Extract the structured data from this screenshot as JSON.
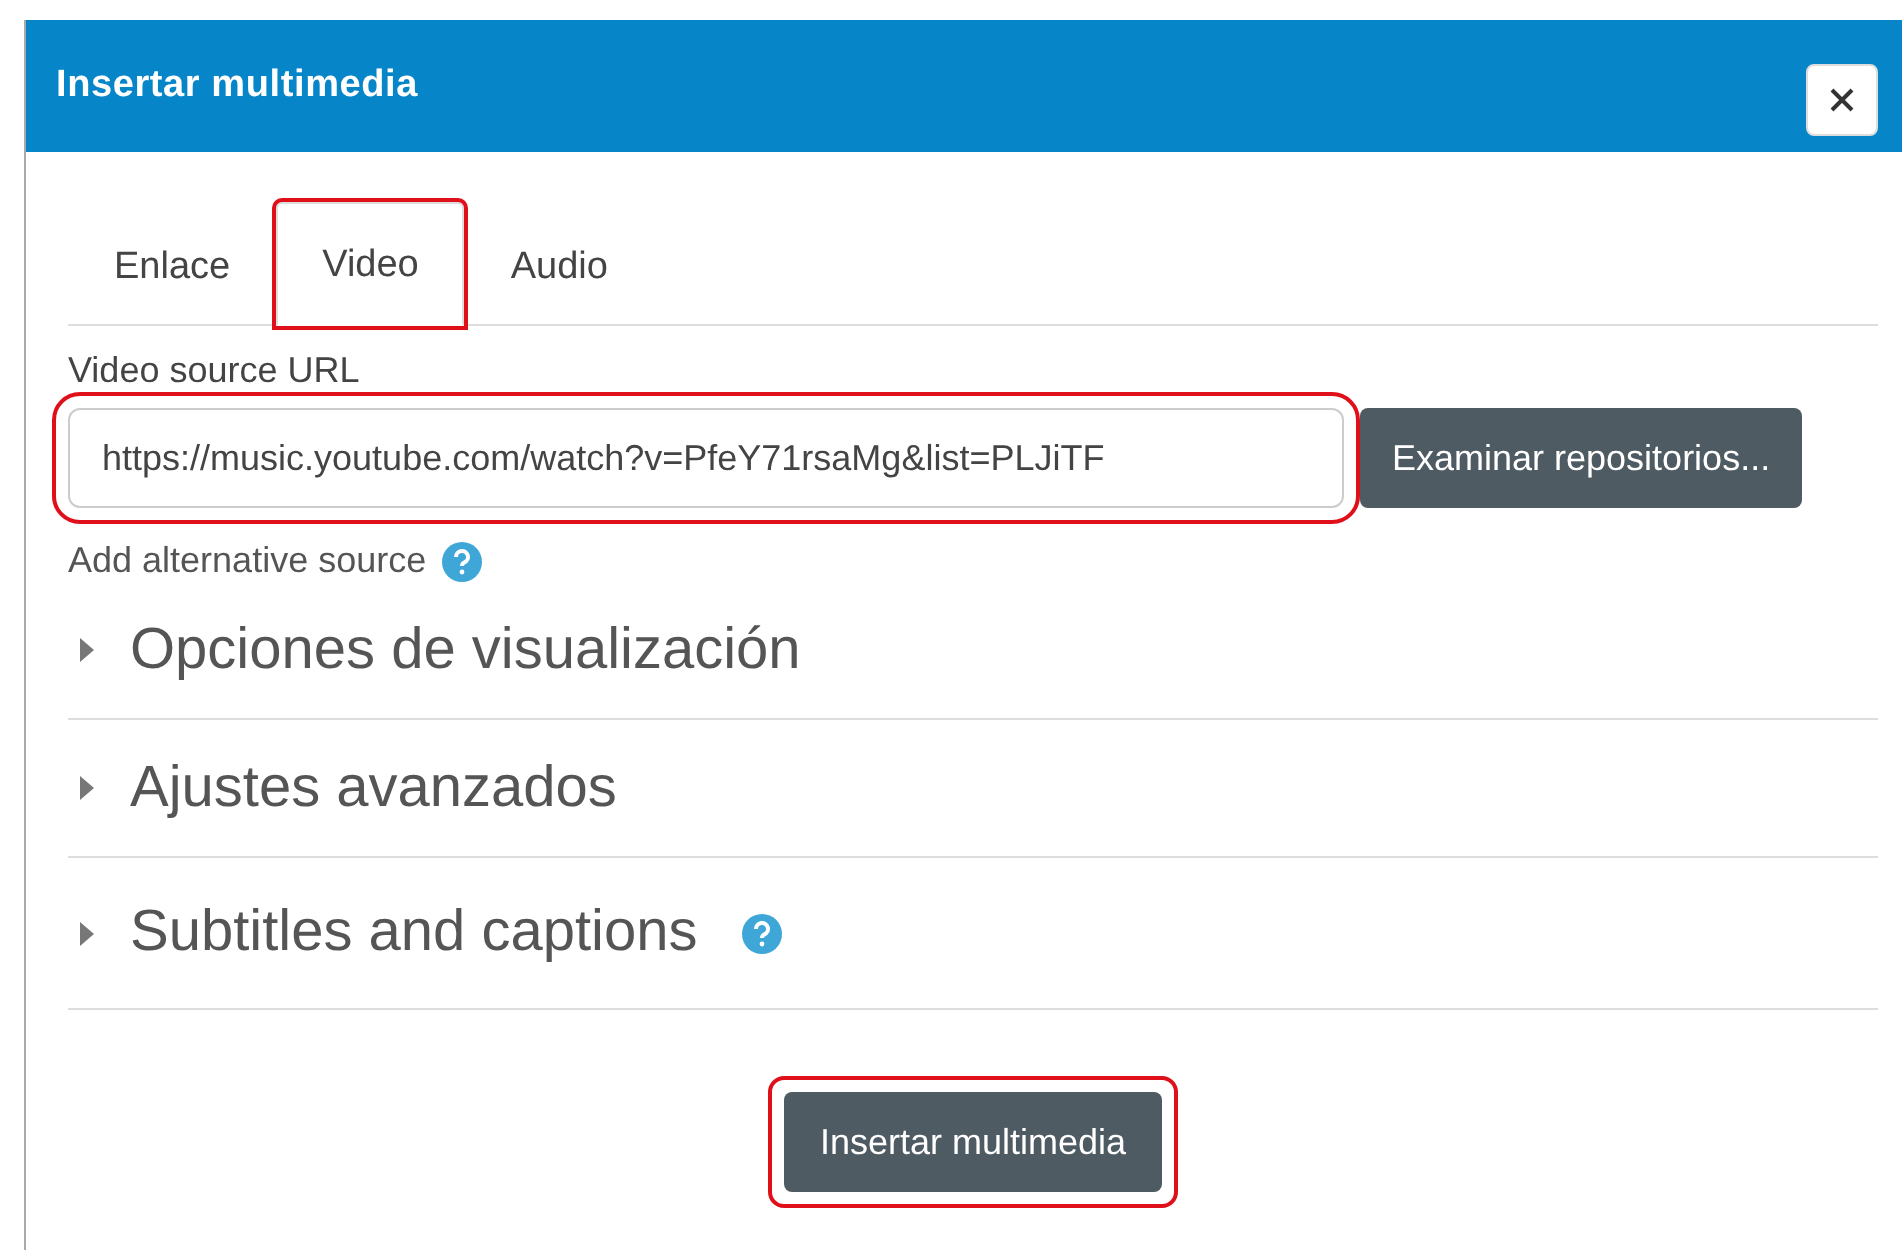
{
  "window": {
    "title": "Insertar multimedia"
  },
  "tabs": [
    {
      "label": "Enlace",
      "selected": false,
      "highlighted": false
    },
    {
      "label": "Video",
      "selected": true,
      "highlighted": true
    },
    {
      "label": "Audio",
      "selected": false,
      "highlighted": false
    }
  ],
  "source": {
    "label": "Video source URL",
    "value": "https://music.youtube.com/watch?v=PfeY71rsaMg&list=PLJiTF",
    "highlighted": true,
    "browse_button": "Examinar repositorios..."
  },
  "alternative_link": "Add alternative source",
  "sections": [
    {
      "title": "Opciones de visualización",
      "expanded": false,
      "help": false
    },
    {
      "title": "Ajustes avanzados",
      "expanded": false,
      "help": false
    },
    {
      "title": "Subtitles and captions",
      "expanded": false,
      "help": true
    }
  ],
  "submit": {
    "label": "Insertar multimedia",
    "highlighted": true
  }
}
